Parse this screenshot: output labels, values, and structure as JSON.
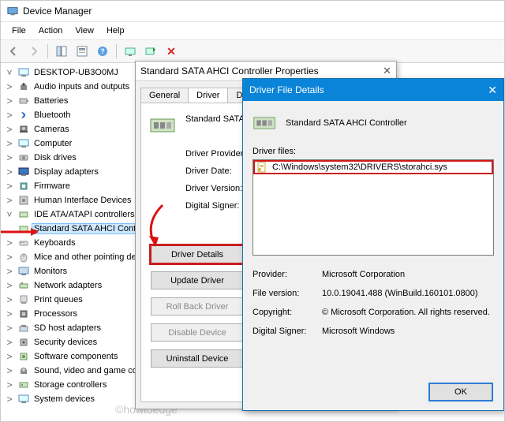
{
  "window": {
    "title": "Device Manager"
  },
  "menu": {
    "file": "File",
    "action": "Action",
    "view": "View",
    "help": "Help"
  },
  "tree": {
    "root": "DESKTOP-UB3O0MJ",
    "items": [
      "Audio inputs and outputs",
      "Batteries",
      "Bluetooth",
      "Cameras",
      "Computer",
      "Disk drives",
      "Display adapters",
      "Firmware",
      "Human Interface Devices",
      "IDE ATA/ATAPI controllers",
      "Keyboards",
      "Mice and other pointing devices",
      "Monitors",
      "Network adapters",
      "Print queues",
      "Processors",
      "SD host adapters",
      "Security devices",
      "Software components",
      "Sound, video and game controllers",
      "Storage controllers",
      "System devices"
    ],
    "ideChild": "Standard SATA AHCI Controller"
  },
  "propsDlg": {
    "title": "Standard SATA AHCI Controller Properties",
    "tabs": {
      "general": "General",
      "driver": "Driver",
      "details": "Details"
    },
    "deviceName": "Standard SATA AHCI Controller",
    "labels": {
      "provider": "Driver Provider:",
      "date": "Driver Date:",
      "version": "Driver Version:",
      "signer": "Digital Signer:"
    },
    "buttons": {
      "details": "Driver Details",
      "update": "Update Driver",
      "rollback": "Roll Back Driver",
      "disable": "Disable Device",
      "uninstall": "Uninstall Device"
    }
  },
  "fileDlg": {
    "title": "Driver File Details",
    "deviceName": "Standard SATA AHCI Controller",
    "filesLabel": "Driver files:",
    "file": "C:\\Windows\\system32\\DRIVERS\\storahci.sys",
    "labels": {
      "provider": "Provider:",
      "fileversion": "File version:",
      "copyright": "Copyright:",
      "signer": "Digital Signer:"
    },
    "values": {
      "provider": "Microsoft Corporation",
      "fileversion": "10.0.19041.488 (WinBuild.160101.0800)",
      "copyright": "© Microsoft Corporation. All rights reserved.",
      "signer": "Microsoft Windows"
    },
    "ok": "OK"
  },
  "watermark": "©howtoedge"
}
